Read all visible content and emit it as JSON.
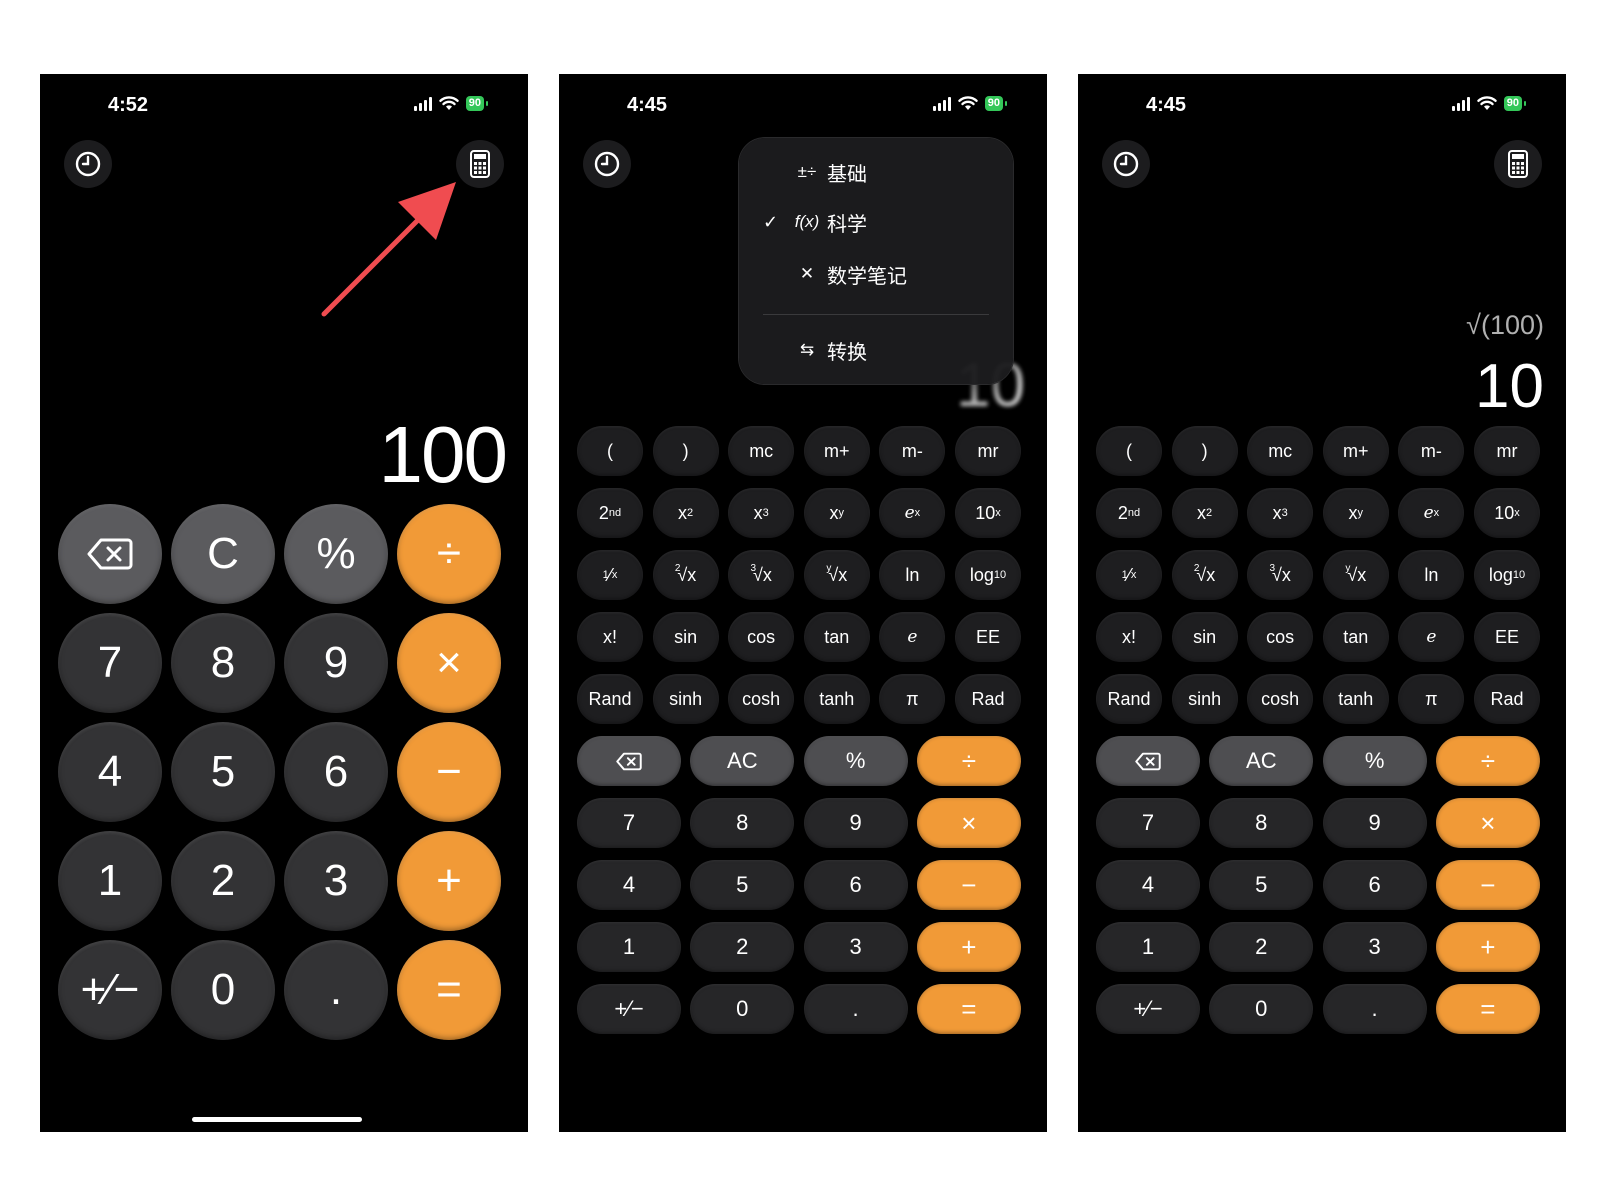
{
  "phones": [
    {
      "status": {
        "time": "4:52",
        "battery": "90"
      },
      "display": {
        "value": "100"
      },
      "basic_keys": [
        "⌫",
        "C",
        "%",
        "÷",
        "7",
        "8",
        "9",
        "×",
        "4",
        "5",
        "6",
        "−",
        "1",
        "2",
        "3",
        "+",
        "+⁄−",
        "0",
        ".",
        "="
      ]
    },
    {
      "status": {
        "time": "4:45",
        "battery": "90"
      },
      "display": {
        "value": "10"
      },
      "menu": {
        "items": [
          {
            "icon": "±÷",
            "label": "基础",
            "checked": false
          },
          {
            "icon": "f(x)",
            "label": "科学",
            "checked": true
          },
          {
            "icon": "✕",
            "label": "数学笔记",
            "checked": false
          },
          {
            "icon": "⇆",
            "label": "转换",
            "checked": false
          }
        ],
        "check_mark": "✓"
      }
    },
    {
      "status": {
        "time": "4:45",
        "battery": "90"
      },
      "display": {
        "expression": "√(100)",
        "value": "10"
      }
    }
  ],
  "sci_keys": {
    "row1": [
      "(",
      ")",
      "mc",
      "m+",
      "m-",
      "mr"
    ],
    "row5": [
      "Rand",
      "sinh",
      "cosh",
      "tanh",
      "π",
      "Rad"
    ],
    "row4": [
      "x!",
      "sin",
      "cos",
      "tan",
      "e",
      "EE"
    ],
    "ln": "ln"
  },
  "num_keys": [
    "⌫",
    "AC",
    "%",
    "÷",
    "7",
    "8",
    "9",
    "×",
    "4",
    "5",
    "6",
    "−",
    "1",
    "2",
    "3",
    "+",
    "+⁄−",
    "0",
    ".",
    "="
  ],
  "colors": {
    "operator": "#f19a37",
    "function_key": "#5b5b5e",
    "digit_key": "#333335",
    "highlight_arrow": "#f04c50"
  }
}
